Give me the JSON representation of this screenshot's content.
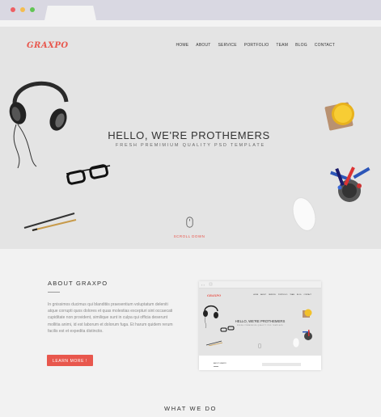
{
  "site": {
    "logo": "GRAXPO",
    "nav": [
      "HOME",
      "ABOUT",
      "SERVICE",
      "PORTFOLIO",
      "TEAM",
      "BLOG",
      "CONTACT"
    ]
  },
  "hero": {
    "title": "HELLO, WE'RE PROTHEMERS",
    "subtitle": "FRESH PREMIMIUM QUALITY PSD TEMPLATE",
    "scroll_label": "SCROLL DOWN"
  },
  "about": {
    "title": "ABOUT GRAXPO",
    "text": "In gnissimos ducimus qui blanditiis praesentium voluptatum deleniti atque corrupti quos dolores et quas molestias excepturi sint occaecati cupiditate non provident, similique sunt in culpa qui officia deserunt mollitia animi, id est laborum et dolorum fuga. Et harum quidem rerum facilis est et expedita distinctio.",
    "button": "LEARN MORE !",
    "preview": {
      "logo": "GRAXPO",
      "title": "HELLO, WE'RE PROTHEMERS",
      "subtitle": "FRESH PREMIMIUM QUALITY PSD TEMPLATE",
      "about": "ABOUT GRAXPO"
    }
  },
  "next_section": "WHAT WE DO",
  "colors": {
    "accent": "#e8574d",
    "hero_bg": "#e4e4e4",
    "page_bg": "#f2f2f2"
  }
}
